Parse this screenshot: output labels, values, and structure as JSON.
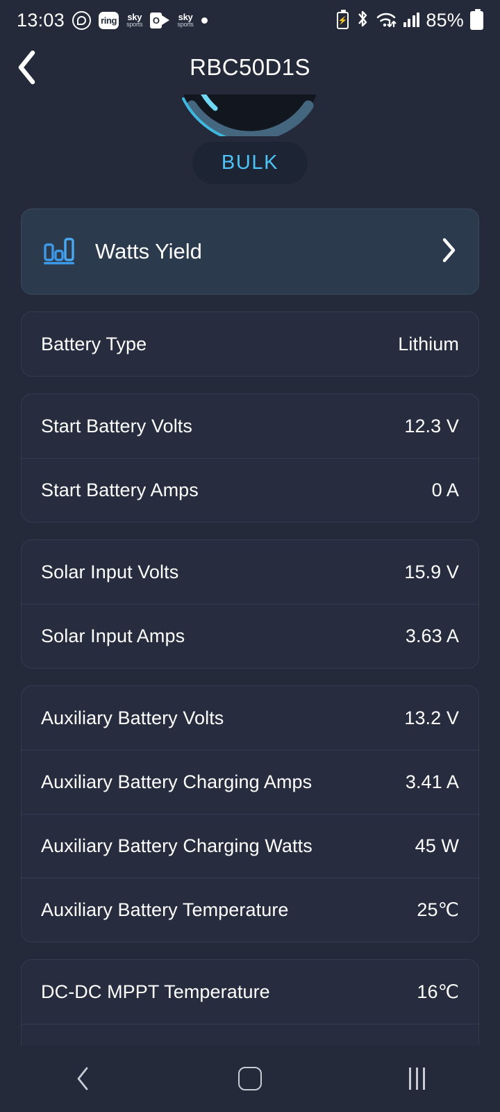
{
  "status_bar": {
    "time": "13:03",
    "left_icons": [
      {
        "name": "whatsapp-icon",
        "label": ""
      },
      {
        "name": "ring-app-icon",
        "label": "ring"
      },
      {
        "name": "sky-sports-icon",
        "label": "sky",
        "sub": "sports"
      },
      {
        "name": "outlook-icon",
        "label": "O"
      },
      {
        "name": "sky-sports-icon-2",
        "label": "sky",
        "sub": "sports"
      },
      {
        "name": "notification-dot-icon",
        "label": ""
      }
    ],
    "right_icons": [
      {
        "name": "battery-saver-icon"
      },
      {
        "name": "bluetooth-icon",
        "glyph": "✱"
      },
      {
        "name": "wifi-icon"
      },
      {
        "name": "cellular-signal-icon"
      }
    ],
    "battery_percent": "85%"
  },
  "header": {
    "title": "RBC50D1S",
    "back_label": "Back"
  },
  "gauge": {
    "status_badge": "BULK",
    "arc_color": "#44677f",
    "highlight_color": "#3fb8e0",
    "dial_color": "#12161f"
  },
  "yield_card": {
    "label": "Watts Yield",
    "icon": "bar-chart-icon",
    "chevron": "›",
    "accent_color": "#2b3a4d",
    "icon_color": "#3e9ae8"
  },
  "cards": [
    {
      "name": "battery-type-card",
      "rows": [
        {
          "label": "Battery Type",
          "value": "Lithium"
        }
      ]
    },
    {
      "name": "start-battery-card",
      "rows": [
        {
          "label": "Start Battery Volts",
          "value": "12.3 V"
        },
        {
          "label": "Start Battery Amps",
          "value": "0 A"
        }
      ]
    },
    {
      "name": "solar-input-card",
      "rows": [
        {
          "label": "Solar Input Volts",
          "value": "15.9 V"
        },
        {
          "label": "Solar Input Amps",
          "value": "3.63 A"
        }
      ]
    },
    {
      "name": "auxiliary-battery-card",
      "rows": [
        {
          "label": "Auxiliary Battery Volts",
          "value": "13.2 V"
        },
        {
          "label": "Auxiliary Battery Charging Amps",
          "value": "3.41 A"
        },
        {
          "label": "Auxiliary Battery Charging Watts",
          "value": "45 W"
        },
        {
          "label": "Auxiliary Battery Temperature",
          "value": "25℃"
        }
      ]
    },
    {
      "name": "dcdc-mppt-card",
      "rows": [
        {
          "label": "DC-DC MPPT Temperature",
          "value": "16℃"
        }
      ]
    }
  ],
  "nav_bar": {
    "back": "back-nav-button",
    "home": "home-nav-button",
    "recents": "recents-nav-button"
  },
  "colors": {
    "page_background": "#242a3a",
    "card_background": "#272d3e",
    "accent_card_background": "#2b3a4d",
    "badge_text": "#4fc3f7",
    "text_primary": "#ffffff",
    "divider": "#343b4f"
  }
}
